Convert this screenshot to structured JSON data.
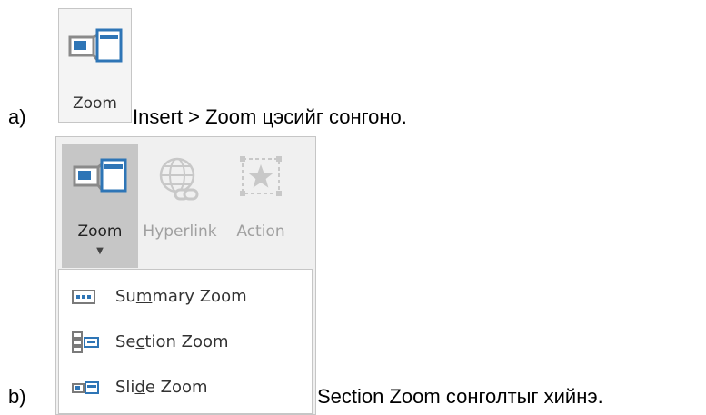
{
  "steps": [
    {
      "letter": "a)",
      "button": {
        "label": "Zoom",
        "icon": "zoom-icon"
      },
      "caption": "Insert > Zoom цэсийг сонгоно."
    },
    {
      "letter": "b)",
      "ribbon": {
        "buttons": [
          {
            "label": "Zoom",
            "icon": "zoom-icon",
            "state": "pressed",
            "has_dropdown": true
          },
          {
            "label": "Hyperlink",
            "icon": "globe-link-icon",
            "state": "disabled"
          },
          {
            "label": "Action",
            "icon": "star-frame-icon",
            "state": "disabled"
          }
        ],
        "menu_items": [
          {
            "label": "Summary Zoom",
            "access_key": "m",
            "icon": "summary-zoom-icon"
          },
          {
            "label": "Section Zoom",
            "access_key": "c",
            "icon": "section-zoom-icon"
          },
          {
            "label": "Slide Zoom",
            "access_key": "d",
            "icon": "slide-zoom-icon"
          }
        ]
      },
      "caption": "Section Zoom сонголтыг хийнэ."
    }
  ],
  "colors": {
    "icon_accent": "#2e75b6",
    "icon_gray": "#8a8a8a",
    "pressed_background": "#c6c6c6",
    "ribbon_background": "#f0f0f0",
    "disabled_text": "#a0a0a0"
  }
}
